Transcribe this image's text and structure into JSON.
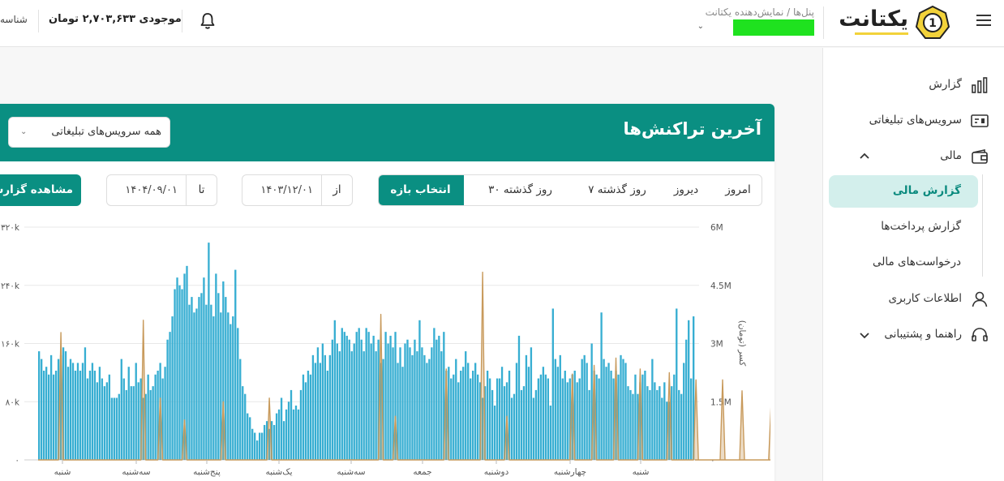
{
  "topbar": {
    "ident": "شناسه",
    "balance": "موجودی ۲,۷۰۳,۶۳۳ تومان",
    "panel_crumb": "پنل‌ها / نمایش‌دهنده یکتانت",
    "logo_text": "یکتانت",
    "logo_digit": "1"
  },
  "sidebar": {
    "items": [
      {
        "label": "گزارش",
        "icon": "bar-chart-icon"
      },
      {
        "label": "سرویس‌های تبلیغاتی",
        "icon": "ad-icon"
      },
      {
        "label": "مالی",
        "icon": "wallet-icon"
      },
      {
        "label": "اطلاعات کاربری",
        "icon": "user-icon"
      },
      {
        "label": "راهنما و پشتیبانی",
        "icon": "headset-icon"
      }
    ],
    "finance_sub": [
      {
        "label": "گزارش مالی",
        "active": true
      },
      {
        "label": "گزارش پرداخت‌ها",
        "active": false
      },
      {
        "label": "درخواست‌های مالی",
        "active": false
      }
    ]
  },
  "card": {
    "title": "آخرین تراکنش‌ها",
    "service_select": "همه سرویس‌های تبلیغاتی",
    "range_tabs": [
      "امروز",
      "دیروز",
      "۷ روز گذشته",
      "۳۰ روز گذشته",
      "انتخاب بازه"
    ],
    "active_range": "انتخاب بازه",
    "from_label": "از",
    "from_value": "۱۴۰۳/۱۲/۰۱",
    "to_label": "تا",
    "to_value": "۱۴۰۴/۰۹/۰۱",
    "view_button": "مشاهده گزارش"
  },
  "colors": {
    "primary": "#0a8f82",
    "bar": "#37aed2",
    "line": "#c89a5c",
    "active_bg": "#d3efec"
  },
  "chart_data": {
    "type": "bar",
    "y_left": {
      "ticks": [
        "۰",
        "۸۰k",
        "۱۶۰k",
        "۲۴۰k",
        "۳۲۰k"
      ],
      "max": 320000
    },
    "y_right": {
      "label": "کسر (تومان)",
      "ticks": [
        "۰",
        "1.5M",
        "3M",
        "4.5M",
        "6M"
      ],
      "max": 6000000
    },
    "x_ticks": [
      "شنبه",
      "سه‌شنبه",
      "پنج‌شنبه",
      "یک‌شنبه",
      "سه‌شنبه",
      "جمعه",
      "دوشنبه",
      "چهارشنبه",
      "شنبه"
    ],
    "series": [
      {
        "type": "bar",
        "axis": "right",
        "values": [
          2.8,
          2.6,
          2.3,
          2.4,
          2.2,
          2.7,
          2.2,
          2.3,
          2.6,
          2.7,
          2.9,
          2.8,
          2.4,
          2.6,
          2.5,
          2.3,
          2.5,
          2.3,
          2.5,
          2.9,
          2.1,
          2.3,
          2.5,
          2.3,
          2.0,
          2.4,
          2.1,
          1.9,
          2.0,
          2.2,
          1.6,
          1.6,
          1.6,
          1.7,
          2.6,
          2.1,
          1.8,
          2.4,
          1.9,
          1.9,
          2.5,
          2.0,
          2.1,
          1.6,
          1.7,
          2.2,
          1.8,
          1.9,
          2.2,
          2.3,
          2.5,
          2.1,
          2.4,
          3.1,
          3.3,
          3.7,
          4.4,
          4.7,
          4.5,
          4.4,
          4.8,
          5.0,
          4.0,
          4.2,
          3.8,
          3.9,
          4.2,
          4.3,
          4.7,
          4.0,
          5.6,
          4.0,
          3.7,
          4.8,
          4.3,
          3.8,
          4.6,
          4.2,
          3.8,
          3.5,
          3.7,
          4.9,
          3.4,
          2.6,
          1.9,
          1.7,
          1.2,
          1.1,
          0.8,
          0.7,
          0.5,
          0.7,
          0.7,
          0.9,
          1.0,
          0.8,
          1.0,
          0.9,
          1.2,
          1.3,
          1.6,
          1.0,
          1.3,
          1.5,
          1.8,
          1.3,
          1.4,
          1.3,
          1.8,
          2.2,
          2.0,
          2.3,
          2.2,
          2.7,
          2.5,
          2.9,
          2.5,
          3.0,
          2.7,
          2.3,
          2.7,
          3.1,
          3.6,
          3.0,
          2.8,
          3.4,
          3.3,
          3.2,
          3.1,
          2.8,
          3.0,
          3.3,
          3.4,
          3.1,
          2.8,
          3.4,
          3.3,
          3.0,
          3.2,
          2.8,
          3.1,
          2.5,
          2.6,
          3.3,
          3.0,
          3.2,
          2.9,
          3.3,
          2.5,
          2.9,
          2.4,
          3.0,
          3.1,
          2.9,
          2.7,
          3.1,
          2.8,
          3.6,
          2.9,
          2.7,
          2.5,
          2.6,
          2.9,
          3.4,
          3.1,
          3.2,
          2.8,
          3.3,
          2.3,
          2.4,
          2.1,
          2.2,
          2.6,
          2.0,
          2.3,
          2.4,
          2.8,
          2.5,
          2.1,
          2.3,
          2.5,
          2.2,
          2.0,
          1.6,
          1.9,
          2.3,
          2.1,
          1.8,
          1.4,
          2.1,
          2.1,
          2.4,
          1.9,
          2.0,
          2.3,
          1.6,
          1.7,
          2.5,
          3.2,
          1.8,
          1.9,
          2.7,
          2.4,
          2.9,
          1.6,
          1.8,
          2.1,
          2.2,
          2.4,
          2.2,
          2.1,
          1.4,
          3.9,
          2.6,
          2.4,
          2.7,
          2.1,
          2.3,
          2.0,
          2.1,
          2.2,
          2.3,
          2.0,
          2.1,
          2.6,
          2.7,
          2.5,
          1.8,
          3.0,
          2.3,
          2.2,
          2.1,
          3.8,
          2.6,
          2.4,
          2.5,
          2.3,
          2.1,
          2.3,
          2.2,
          2.7,
          2.6,
          2.5,
          1.9,
          1.8,
          1.7,
          2.2,
          1.7,
          2.0,
          2.2,
          2.3,
          1.9,
          1.8,
          2.6,
          2.0,
          1.8,
          1.9,
          1.6,
          2.0,
          1.5,
          1.5,
          1.9,
          2.2,
          3.9,
          1.8,
          1.7,
          2.5,
          3.1,
          3.6,
          2.1,
          3.7
        ],
        "value_unit": "M"
      },
      {
        "type": "line",
        "axis": "left",
        "spikes": [
          {
            "index": 9,
            "value": 175000
          },
          {
            "index": 43,
            "value": 192000
          },
          {
            "index": 50,
            "value": 85000
          },
          {
            "index": 60,
            "value": 55000
          },
          {
            "index": 76,
            "value": 80000
          },
          {
            "index": 95,
            "value": 85000
          },
          {
            "index": 141,
            "value": 200000
          },
          {
            "index": 147,
            "value": 60000
          },
          {
            "index": 168,
            "value": 125000
          },
          {
            "index": 183,
            "value": 258000
          },
          {
            "index": 193,
            "value": 60000
          },
          {
            "index": 220,
            "value": 118000
          },
          {
            "index": 229,
            "value": 130000
          },
          {
            "index": 238,
            "value": 140000
          },
          {
            "index": 248,
            "value": 125000
          },
          {
            "index": 260,
            "value": 120000
          },
          {
            "index": 271,
            "value": 110000
          },
          {
            "index": 282,
            "value": 110000
          },
          {
            "index": 290,
            "value": 95000
          },
          {
            "index": 302,
            "value": 75000
          }
        ]
      }
    ]
  }
}
